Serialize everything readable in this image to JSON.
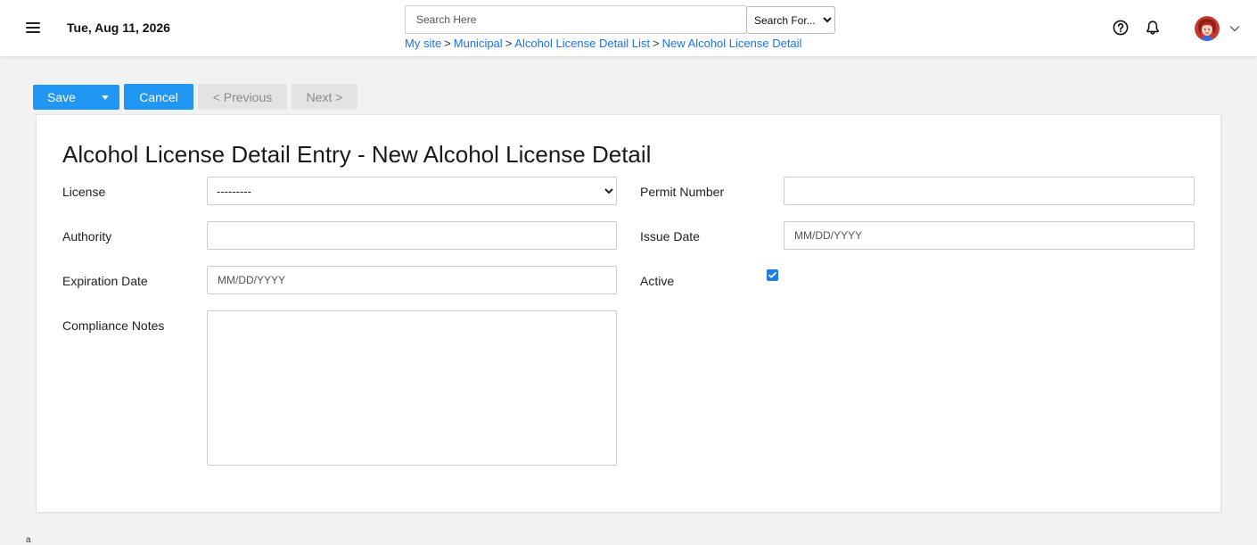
{
  "header": {
    "date": "Tue, Aug 11, 2026",
    "search_placeholder": "Search Here",
    "search_scope_selected": "Search For...",
    "breadcrumb": [
      {
        "label": "My site"
      },
      {
        "label": "Municipal"
      },
      {
        "label": "Alcohol License Detail List"
      },
      {
        "label": "New Alcohol License Detail"
      }
    ],
    "breadcrumb_separator": ">",
    "icons": {
      "menu": "hamburger-menu-icon",
      "help": "help-circle-icon",
      "notifications": "bell-icon",
      "profile_menu": "chevron-down-icon"
    }
  },
  "toolbar": {
    "save_label": "Save",
    "cancel_label": "Cancel",
    "previous_label": "< Previous",
    "next_label": "Next >"
  },
  "form": {
    "title": "Alcohol License Detail Entry - New Alcohol License Detail",
    "license": {
      "label": "License",
      "selected": "---------"
    },
    "permit_number": {
      "label": "Permit Number",
      "value": ""
    },
    "authority": {
      "label": "Authority",
      "value": ""
    },
    "issue_date": {
      "label": "Issue Date",
      "placeholder": "MM/DD/YYYY"
    },
    "expiration_date": {
      "label": "Expiration Date",
      "placeholder": "MM/DD/YYYY"
    },
    "active": {
      "label": "Active",
      "checked": true
    },
    "compliance_notes": {
      "label": "Compliance Notes",
      "value": ""
    }
  },
  "footer": {
    "mark": "a"
  },
  "colors": {
    "primary": "#2196f3",
    "link": "#1a73e8",
    "muted_button": "#e3e3e3",
    "background": "#f2f2f2"
  }
}
